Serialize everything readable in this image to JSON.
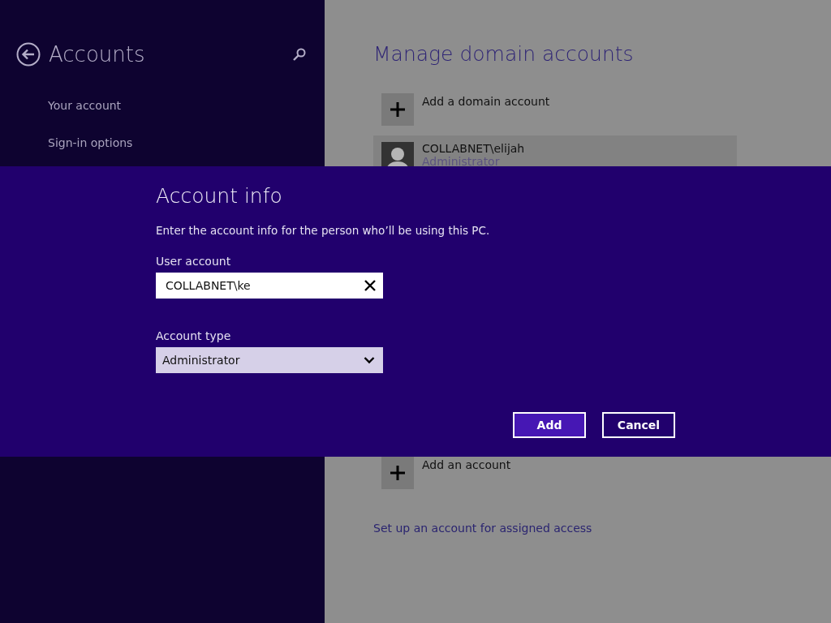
{
  "sidebar": {
    "title": "Accounts",
    "items": [
      {
        "label": "Your account"
      },
      {
        "label": "Sign-in options"
      }
    ]
  },
  "main": {
    "title": "Manage domain accounts",
    "add_domain_account": "Add a domain account",
    "accounts": [
      {
        "name": "COLLABNET\\elijah",
        "role": "Administrator",
        "selected": true
      }
    ],
    "add_account": "Add an account",
    "assigned_access_link": "Set up an account for assigned access"
  },
  "dialog": {
    "title": "Account info",
    "description": "Enter the account info for the person who’ll be using this PC.",
    "user_account": {
      "label": "User account",
      "value": "COLLABNET\\ke"
    },
    "account_type": {
      "label": "Account type",
      "value": "Administrator"
    },
    "buttons": [
      {
        "label": "Add",
        "kind": "primary"
      },
      {
        "label": "Cancel",
        "kind": "secondary"
      }
    ]
  }
}
